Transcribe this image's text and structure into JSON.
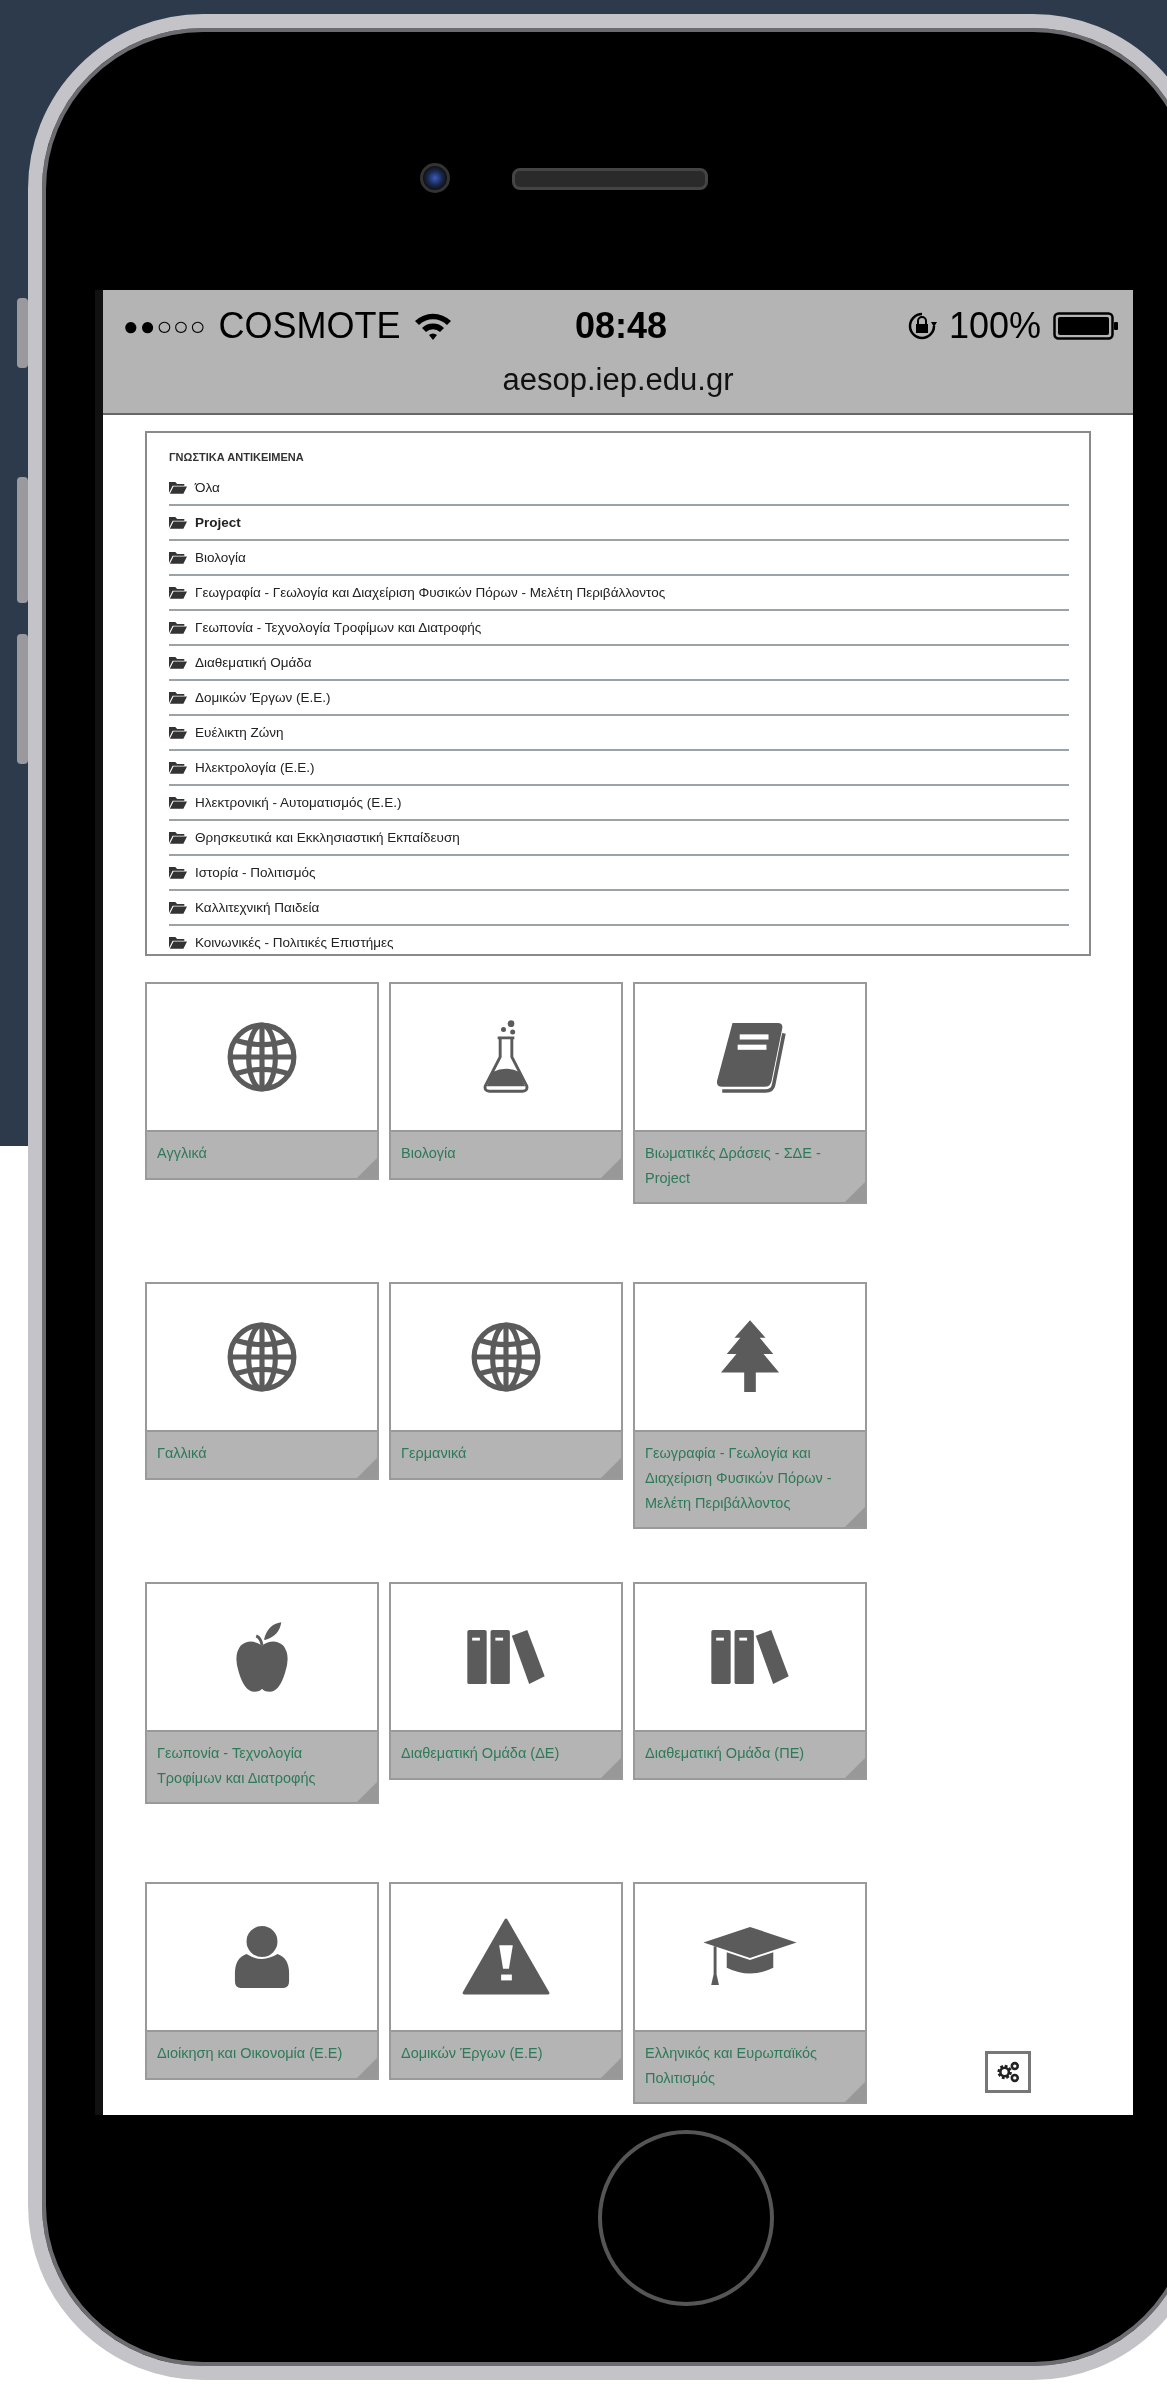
{
  "status_bar": {
    "signal": "●●○○○",
    "carrier": "COSMOTE",
    "time": "08:48",
    "battery": "100%"
  },
  "address_bar": {
    "url": "aesop.iep.edu.gr"
  },
  "category_list": {
    "title": "ΓΝΩΣΤΙΚΑ ΑΝΤΙΚΕΙΜΕΝΑ",
    "items": [
      {
        "label": "Όλα",
        "selected": false
      },
      {
        "label": "Project",
        "selected": true
      },
      {
        "label": "Βιολογία",
        "selected": false
      },
      {
        "label": "Γεωγραφία - Γεωλογία και Διαχείριση Φυσικών Πόρων - Μελέτη Περιβάλλοντος",
        "selected": false
      },
      {
        "label": "Γεωπονία - Τεχνολογία Τροφίμων και Διατροφής",
        "selected": false
      },
      {
        "label": "Διαθεματική Ομάδα",
        "selected": false
      },
      {
        "label": "Δομικών Έργων (Ε.Ε.)",
        "selected": false
      },
      {
        "label": "Ευέλικτη Ζώνη",
        "selected": false
      },
      {
        "label": "Ηλεκτρολογία (Ε.Ε.)",
        "selected": false
      },
      {
        "label": "Ηλεκτρονική - Αυτοματισμός (Ε.Ε.)",
        "selected": false
      },
      {
        "label": "Θρησκευτικά και Εκκλησιαστική Εκπαίδευση",
        "selected": false
      },
      {
        "label": "Ιστορία - Πολιτισμός",
        "selected": false
      },
      {
        "label": "Καλλιτεχνική Παιδεία",
        "selected": false
      },
      {
        "label": "Κοινωνικές - Πολιτικές Επιστήμες",
        "selected": false
      }
    ]
  },
  "subject_tiles": [
    {
      "label": "Αγγλικά"
    },
    {
      "label": "Βιολογία"
    },
    {
      "label": "Βιωματικές Δράσεις - ΣΔΕ - Project"
    },
    {
      "label": "Γαλλικά"
    },
    {
      "label": "Γερμανικά"
    },
    {
      "label": "Γεωγραφία - Γεωλογία και Διαχείριση Φυσικών Πόρων - Μελέτη Περιβάλλοντος"
    },
    {
      "label": "Γεωπονία - Τεχνολογία Τροφίμων και Διατροφής"
    },
    {
      "label": "Διαθεματική Ομάδα (ΔΕ)"
    },
    {
      "label": "Διαθεματική Ομάδα (ΠΕ)"
    },
    {
      "label": "Διοίκηση και Οικονομία (Ε.Ε)"
    },
    {
      "label": "Δομικών Έργων (Ε.Ε)"
    },
    {
      "label": "Ελληνικός και Ευρωπαϊκός Πολιτισμός"
    }
  ]
}
